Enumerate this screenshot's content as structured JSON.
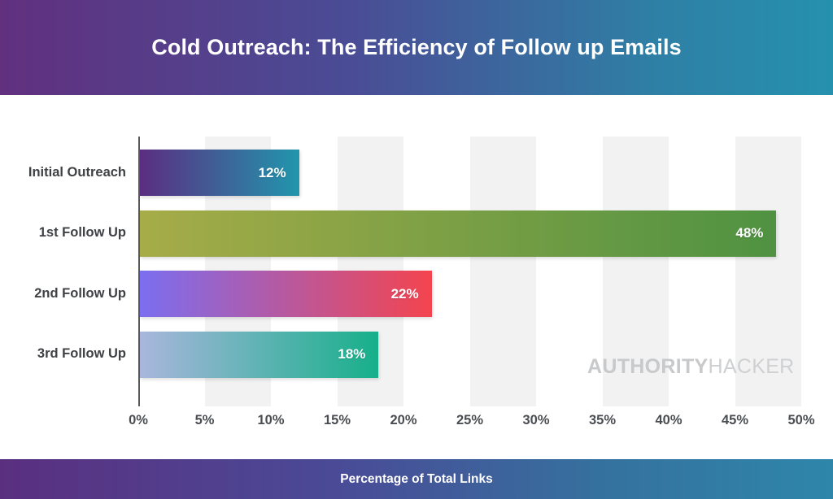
{
  "header": {
    "title": "Cold Outreach: The Efficiency of Follow up Emails",
    "gradient_from": "#61307f",
    "gradient_to": "#2591ae"
  },
  "footer": {
    "title": "Percentage of Total Links",
    "gradient_from": "#5a2f80",
    "gradient_to": "#2e86ab"
  },
  "watermark": {
    "bold_text": "AUTHORITY",
    "light_text": "HACKER",
    "color": "#c8c9cb"
  },
  "chart_data": {
    "type": "bar",
    "orientation": "horizontal",
    "title": "Cold Outreach: The Efficiency of Follow up Emails",
    "xlabel": "Percentage of Total Links",
    "ylabel": "",
    "categories": [
      "Initial Outreach",
      "1st Follow Up",
      "2nd Follow Up",
      "3rd Follow Up"
    ],
    "values": [
      12,
      48,
      22,
      18
    ],
    "value_labels": [
      "12%",
      "48%",
      "22%",
      "18%"
    ],
    "xlim": [
      0,
      50
    ],
    "xticks": [
      0,
      5,
      10,
      15,
      20,
      25,
      30,
      35,
      40,
      45,
      50
    ],
    "xtick_labels": [
      "0%",
      "5%",
      "10%",
      "15%",
      "20%",
      "25%",
      "30%",
      "35%",
      "40%",
      "45%",
      "50%"
    ],
    "grid": "alternating-vertical-bands",
    "band_color": "#f2f2f2",
    "legend": null,
    "bar_gradients": [
      {
        "from": "#5b2d82",
        "to": "#2196ad"
      },
      {
        "from": "#a6ac48",
        "to": "#4f9242"
      },
      {
        "from": "#7b6ef0",
        "to": "#f4444e"
      },
      {
        "from": "#a9b6dd",
        "to": "#16b08a"
      }
    ]
  }
}
